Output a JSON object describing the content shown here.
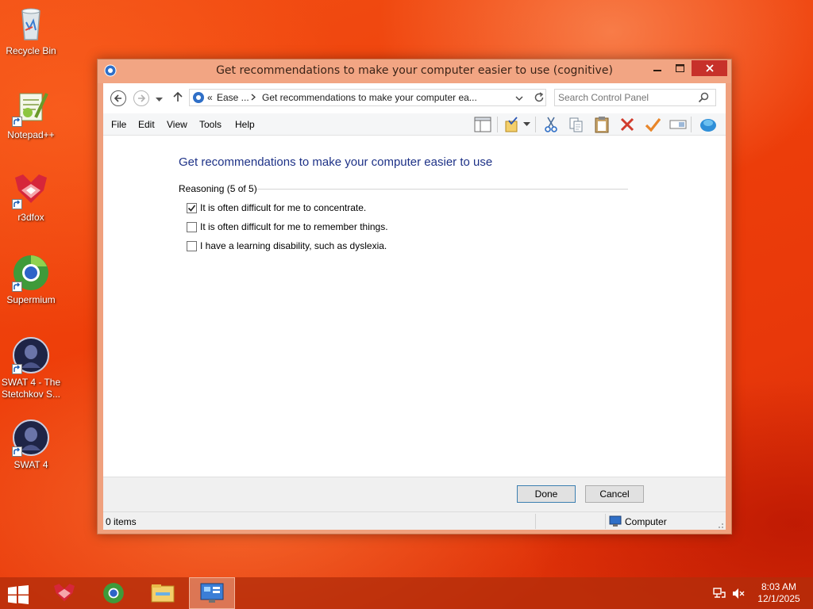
{
  "desktop": {
    "icons": [
      {
        "label": "Recycle Bin"
      },
      {
        "label": "Notepad++"
      },
      {
        "label": "r3dfox"
      },
      {
        "label": "Supermium"
      },
      {
        "label": "SWAT 4 - The Stetchkov S..."
      },
      {
        "label": "SWAT 4"
      }
    ]
  },
  "window": {
    "title": "Get recommendations to make your computer easier to use (cognitive)",
    "controls": {
      "minimize": "minimize-icon",
      "maximize": "maximize-icon",
      "close": "close-icon"
    }
  },
  "address": {
    "overflow": "«",
    "crumb1": "Ease ...",
    "crumb2": "Get recommendations to make your computer ea...",
    "search_placeholder": "Search Control Panel"
  },
  "menu": {
    "file": "File",
    "edit": "Edit",
    "view": "View",
    "tools": "Tools",
    "help": "Help"
  },
  "content": {
    "heading": "Get recommendations to make your computer easier to use",
    "section_title": "Reasoning (5 of 5)",
    "options": [
      {
        "label": "It is often difficult for me to concentrate.",
        "checked": true
      },
      {
        "label": "It is often difficult for me to remember things.",
        "checked": false
      },
      {
        "label": "I have a learning disability, such as dyslexia.",
        "checked": false
      }
    ]
  },
  "buttons": {
    "done": "Done",
    "cancel": "Cancel"
  },
  "status": {
    "items": "0 items",
    "location": "Computer"
  },
  "taskbar": {
    "time": "8:03 AM",
    "date": "12/1/2025"
  },
  "colors": {
    "desktop": "#ee3f0a",
    "titlebar": "#f2a583",
    "close_button": "#c7312a",
    "heading": "#1e3287"
  }
}
